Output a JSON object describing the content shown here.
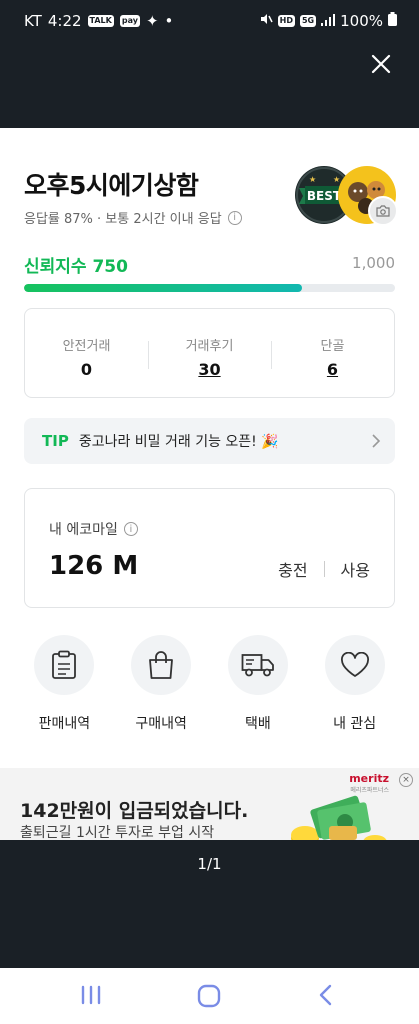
{
  "status": {
    "carrier": "KT",
    "time": "4:22",
    "pay_badge": "pay",
    "talk_badge": "TALK",
    "hd": "HD",
    "net": "5G",
    "battery": "100%"
  },
  "shop": {
    "name": "오후5시에기상함",
    "subtitle": "응답률 87% · 보통 2시간 이내 응답",
    "best_badge": "BEST"
  },
  "trust": {
    "label": "신뢰지수 750",
    "max": "1,000",
    "level": 0.75,
    "fill_color": "#16c25e"
  },
  "stats": [
    {
      "label": "안전거래",
      "value": "0"
    },
    {
      "label": "거래후기",
      "value": "30"
    },
    {
      "label": "단골",
      "value": "6"
    }
  ],
  "tip": {
    "label": "TIP",
    "text": "중고나라 비밀 거래 기능 오픈! 🎉"
  },
  "mileage": {
    "title": "내 에코마일",
    "value": "126 M",
    "charge": "충전",
    "use": "사용"
  },
  "menu": [
    {
      "label": "판매내역",
      "icon": "clipboard-icon"
    },
    {
      "label": "구매내역",
      "icon": "shopping-bag-icon"
    },
    {
      "label": "택배",
      "icon": "truck-icon"
    },
    {
      "label": "내 관심",
      "icon": "heart-icon"
    }
  ],
  "ad": {
    "title": "142만원이 입금되었습니다.",
    "subtitle": "출퇴근길 1시간 투자로 부업 시작",
    "brand": "meritz",
    "brand_sub": "메리츠파트너스"
  },
  "pager": "1/1"
}
